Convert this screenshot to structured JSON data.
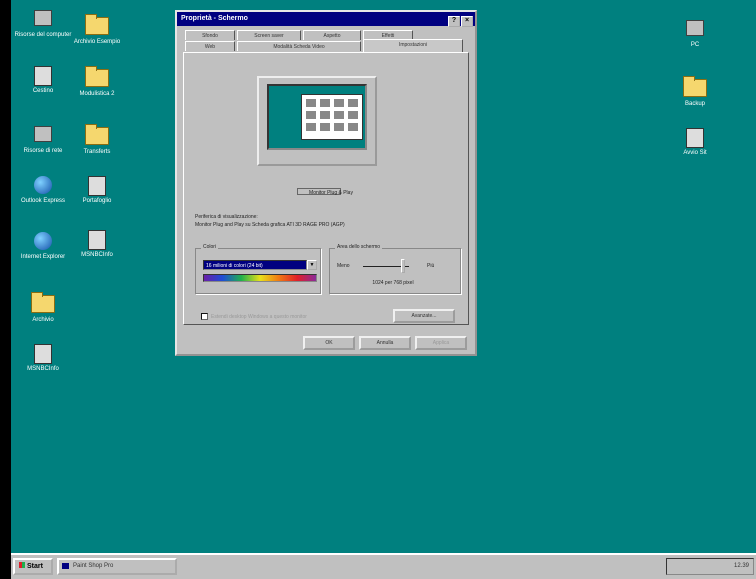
{
  "desktop_icons_left": [
    {
      "label": "Risorse del computer",
      "icon": "computer-icon"
    },
    {
      "label": "Archivio Esempio",
      "icon": "folder-icon"
    },
    {
      "label": "Cestino",
      "icon": "recycle-bin-icon"
    },
    {
      "label": "Modulistica 2",
      "icon": "folder-icon"
    },
    {
      "label": "Risorse di rete",
      "icon": "network-icon"
    },
    {
      "label": "Transferts",
      "icon": "folder-icon"
    },
    {
      "label": "Outlook Express",
      "icon": "outlook-icon"
    },
    {
      "label": "Portafoglio",
      "icon": "briefcase-icon"
    },
    {
      "label": "Internet Explorer",
      "icon": "globe-icon"
    },
    {
      "label": "MSNBCInfo",
      "icon": "app-icon"
    },
    {
      "label": "Archivio",
      "icon": "folder-icon"
    },
    {
      "label": "MSNBCInfo",
      "icon": "app-icon"
    }
  ],
  "desktop_icons_right": [
    {
      "label": "PC",
      "icon": "computer-icon"
    },
    {
      "label": "Backup",
      "icon": "folder-icon"
    },
    {
      "label": "Avvio Sit",
      "icon": "shortcut-icon"
    }
  ],
  "window": {
    "title": "Proprietà - Schermo",
    "tabs_row1": [
      "Sfondo",
      "Screen saver",
      "Aspetto",
      "Effetti"
    ],
    "tabs_row2": [
      "Web",
      "Modalità Scheda Video",
      "Impostazioni"
    ],
    "monitor_caption": "Monitor Plug & Play",
    "display_label": "Periferica di visualizzazione:",
    "display_value": "Monitor Plug and Play su Scheda grafica ATI 3D RAGE PRO (AGP)",
    "colors_label": "Colori",
    "colors_value": "16 milioni di colori (24 bit)",
    "area_label": "Area dello schermo",
    "area_less": "Meno",
    "area_more": "Più",
    "area_value": "1024 per 768 pixel",
    "checkbox_label": "Estendi desktop Windows a questo monitor",
    "advanced_button": "Avanzate...",
    "ok_button": "OK",
    "cancel_button": "Annulla",
    "apply_button": "Applica"
  },
  "taskbar": {
    "start_label": "Start",
    "task_label": "Paint Shop Pro",
    "clock": "12.39"
  },
  "colors": {
    "desktop": "#00807f",
    "title_bar": "#000080",
    "face": "#c0c0c0"
  }
}
